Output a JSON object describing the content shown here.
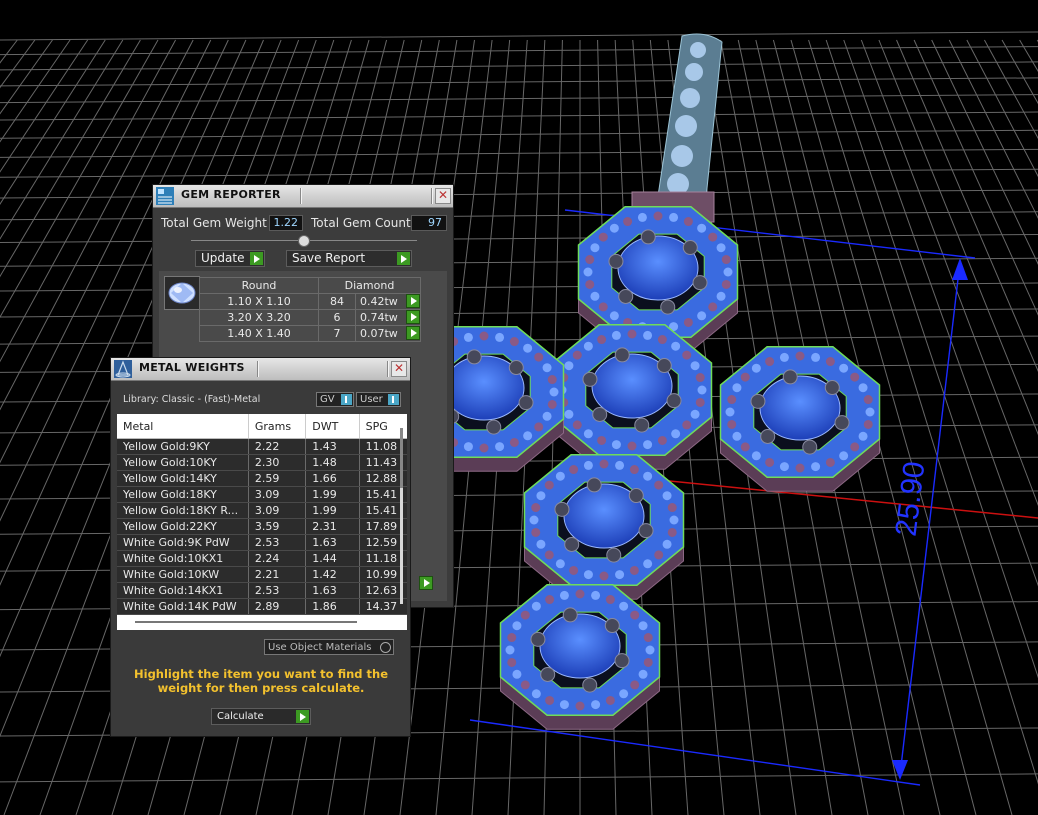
{
  "viewport": {
    "dimension_label": "25.90"
  },
  "gem_reporter": {
    "title": "GEM REPORTER",
    "total_gem_weight_label": "Total Gem Weight",
    "total_gem_weight_value": "1.22",
    "total_gem_count_label": "Total Gem Count",
    "total_gem_count_value": "97",
    "update_label": "Update",
    "save_report_label": "Save Report",
    "shape_header": "Round",
    "type_header": "Diamond",
    "rows": [
      {
        "size": "1.10 X 1.10",
        "count": "84",
        "weight": "0.42tw"
      },
      {
        "size": "3.20 X 3.20",
        "count": "6",
        "weight": "0.74tw"
      },
      {
        "size": "1.40 X 1.40",
        "count": "7",
        "weight": "0.07tw"
      }
    ]
  },
  "metal_weights": {
    "title": "METAL WEIGHTS",
    "library_label": "Library: Classic - (Fast)-Metal",
    "toggle_gv": "GV",
    "toggle_user": "User",
    "columns": [
      "Metal",
      "Grams",
      "DWT",
      "SPG"
    ],
    "rows": [
      [
        "Yellow Gold:9KY",
        "2.22",
        "1.43",
        "11.08"
      ],
      [
        "Yellow Gold:10KY",
        "2.30",
        "1.48",
        "11.43"
      ],
      [
        "Yellow Gold:14KY",
        "2.59",
        "1.66",
        "12.88"
      ],
      [
        "Yellow Gold:18KY",
        "3.09",
        "1.99",
        "15.41"
      ],
      [
        "Yellow Gold:18KY R...",
        "3.09",
        "1.99",
        "15.41"
      ],
      [
        "Yellow Gold:22KY",
        "3.59",
        "2.31",
        "17.89"
      ],
      [
        "White Gold:9K PdW",
        "2.53",
        "1.63",
        "12.59"
      ],
      [
        "White Gold:10KX1",
        "2.24",
        "1.44",
        "11.18"
      ],
      [
        "White Gold:10KW",
        "2.21",
        "1.42",
        "10.99"
      ],
      [
        "White Gold:14KX1",
        "2.53",
        "1.63",
        "12.63"
      ],
      [
        "White Gold:14K PdW",
        "2.89",
        "1.86",
        "14.37"
      ]
    ],
    "use_object_materials_label": "Use Object Materials",
    "hint_text": "Highlight the item you want to find the weight for then press calculate.",
    "calculate_label": "Calculate"
  }
}
